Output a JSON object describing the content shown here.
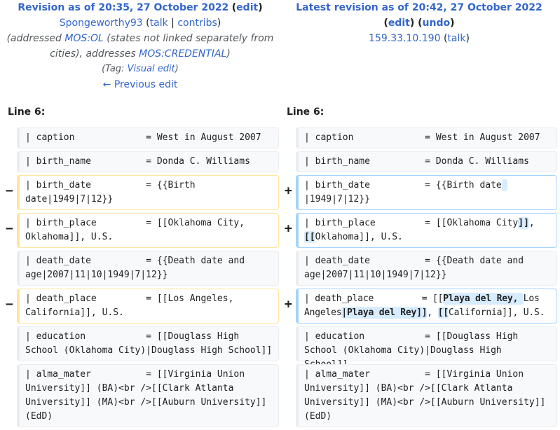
{
  "left": {
    "title": "Revision as of 20:35, 27 October 2022",
    "edit": "edit",
    "user": "Spongeworthy93",
    "talk": "talk",
    "contribs": "contribs",
    "summary_a": "(addressed ",
    "summary_link1": "MOS:OL",
    "summary_b": " (states not linked separately from cities), addresses ",
    "summary_link2": "MOS:CREDENTIAL",
    "summary_c": ")",
    "tag_prefix": "(Tag: ",
    "tag_link": "Visual edit",
    "tag_suffix": ")",
    "prev_edit": "← Previous edit",
    "line_label": "Line 6:"
  },
  "right": {
    "title": "Latest revision as of 20:42, 27 October 2022",
    "edit": "edit",
    "undo": "undo",
    "user": "159.33.10.190",
    "talk": "talk",
    "line_label": "Line 6:"
  },
  "markers": {
    "minus": "−",
    "plus": "+"
  },
  "rows": {
    "caption": "| caption             = West in August 2007",
    "birth_name": "| birth_name          = Donda C. Williams",
    "birth_date_old": "| birth_date          = {{Birth date|1949|7|12}}",
    "birth_date_new_a": "| birth_date          = {{Birth date",
    "birth_date_new_ins": " ",
    "birth_date_new_b": "|1949|7|12}}",
    "birth_place_old": "| birth_place         = [[Oklahoma City, Oklahoma]], U.S.",
    "birth_place_new_a": "| birth_place         = [[Oklahoma City",
    "birth_place_new_ins1": "]]",
    "birth_place_new_b": ", ",
    "birth_place_new_ins2": "[[",
    "birth_place_new_c": "Oklahoma]], U.S.",
    "death_date": "| death_date          = {{Death date and age|2007|11|10|1949|7|12}}",
    "death_place_old": "| death_place         = [[Los Angeles, California]], U.S.",
    "death_place_new_a": "| death_place         = [[",
    "death_place_new_ins1": "Playa del Rey, ",
    "death_place_new_b": "Los Angeles",
    "death_place_new_ins2": "|Playa del Rey]]",
    "death_place_new_c": ", ",
    "death_place_new_ins3": "[[",
    "death_place_new_d": "California]], U.S.",
    "education": "| education           = [[Douglass High School (Oklahoma City)|Douglass High School]]",
    "alma_mater": "| alma_mater          = [[Virginia Union University]] (BA)<br />[[Clark Atlanta University]] (MA)<br />[[Auburn University]] (EdD)"
  }
}
